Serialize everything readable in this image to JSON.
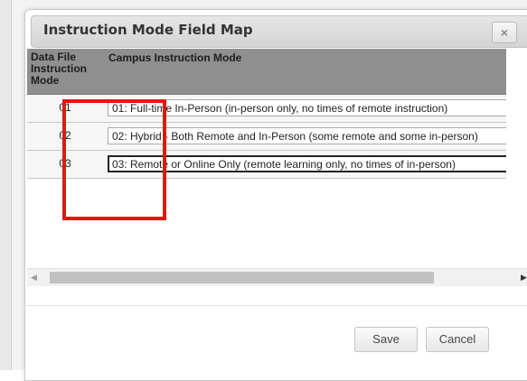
{
  "dialog": {
    "title": "Instruction Mode Field Map",
    "close_label": "×"
  },
  "table": {
    "headers": [
      "Data File Instruction Mode",
      "Campus Instruction Mode"
    ],
    "rows": [
      {
        "code": "01",
        "value": "01: Full-time In-Person (in-person only, no times of remote instruction)"
      },
      {
        "code": "02",
        "value": "02: Hybrid - Both Remote and In-Person (some remote and some in-person)"
      },
      {
        "code": "03",
        "value": "03: Remote or Online Only (remote learning only, no times of in-person)"
      }
    ]
  },
  "scrollbar": {
    "left_arrow": "◀",
    "right_arrow": "▶"
  },
  "footer": {
    "save_label": "Save",
    "cancel_label": "Cancel"
  },
  "colors": {
    "highlight": "#ee1111",
    "header_bg": "#8f8f8f"
  }
}
